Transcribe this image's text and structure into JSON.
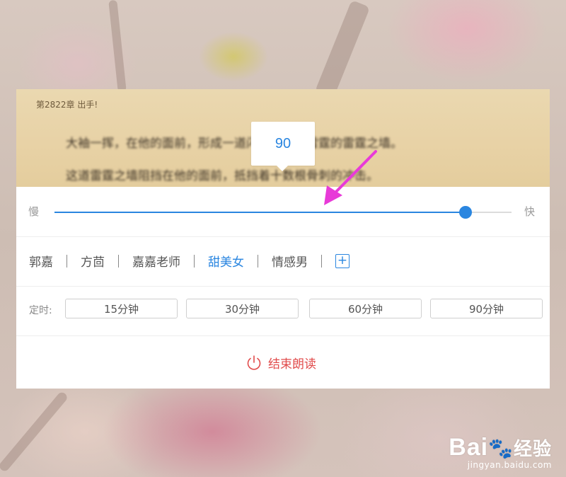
{
  "book": {
    "chapter_title": "第2822章 出手!",
    "blurred_line_1": "大袖一挥，在他的面前，形成一道闪烁着无尽雷霆的雷霆之墙。",
    "blurred_line_2": "这道雷霆之墙阻挡在他的面前，抵挡着十数根骨刺的冲击。"
  },
  "speed": {
    "value": "90",
    "slow_label": "慢",
    "fast_label": "快",
    "level_percent": 90
  },
  "voices": {
    "items": [
      "郭嘉",
      "方茴",
      "嘉嘉老师",
      "甜美女",
      "情感男"
    ],
    "selected": "甜美女",
    "add_label": "+"
  },
  "timer": {
    "label": "定时:",
    "options": [
      "15分钟",
      "30分钟",
      "60分钟",
      "90分钟"
    ]
  },
  "end_reading": {
    "label": "结束朗读"
  },
  "watermark": {
    "logo": "Bai",
    "logo_suffix": "经验",
    "url": "jingyan.baidu.com"
  },
  "colors": {
    "accent": "#2a86e0",
    "danger": "#e14b4b",
    "annotation_arrow": "#e83ad8"
  }
}
